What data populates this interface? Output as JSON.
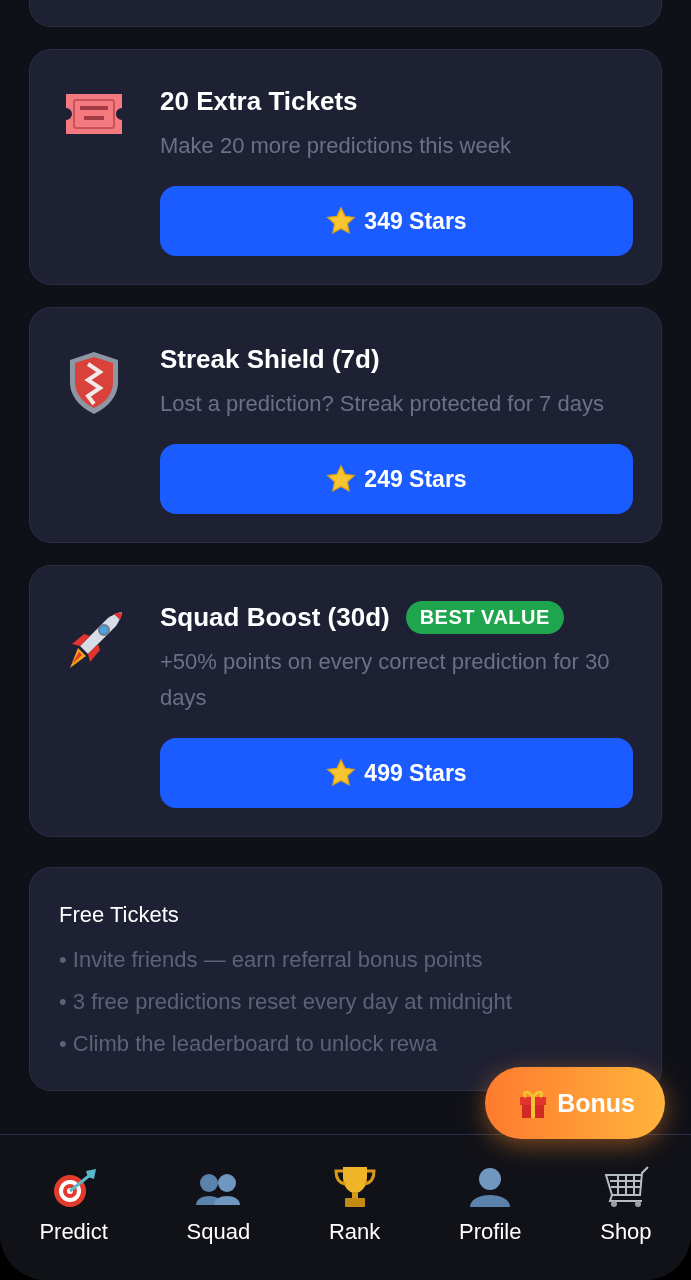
{
  "products": [
    {
      "kind": "ticket",
      "title": "20 Extra Tickets",
      "description": "Make 20 more predictions this week",
      "price": "349 Stars"
    },
    {
      "kind": "shield",
      "title": "Streak Shield (7d)",
      "description": "Lost a prediction? Streak protected for 7 days",
      "price": "249 Stars"
    },
    {
      "kind": "rocket",
      "title": "Squad Boost (30d)",
      "badge": "BEST VALUE",
      "description": "+50% points on every correct prediction for 30 days",
      "price": "499 Stars"
    }
  ],
  "free_tickets": {
    "title": "Free Tickets",
    "items": [
      "• Invite friends — earn referral bonus points",
      "• 3 free predictions reset every day at midnight",
      "• Climb the leaderboard to unlock rewa"
    ]
  },
  "bonus_button": {
    "label": "Bonus"
  },
  "nav": [
    {
      "kind": "target",
      "label": "Predict"
    },
    {
      "kind": "people",
      "label": "Squad"
    },
    {
      "kind": "trophy",
      "label": "Rank"
    },
    {
      "kind": "person",
      "label": "Profile"
    },
    {
      "kind": "cart",
      "label": "Shop"
    }
  ]
}
